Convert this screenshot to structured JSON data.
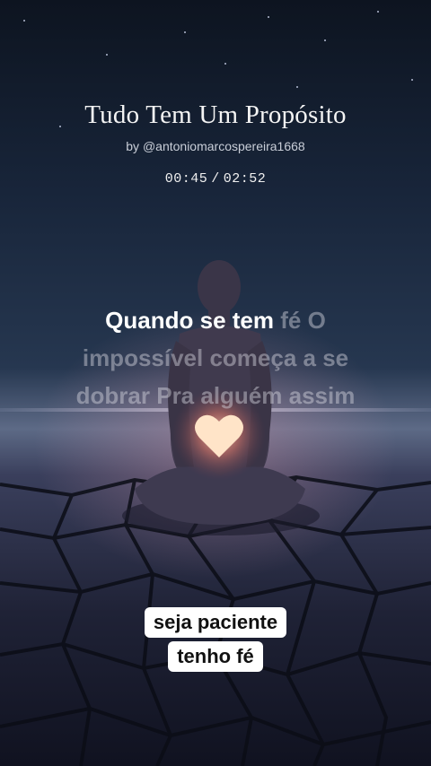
{
  "song": {
    "title": "Tudo Tem Um Propósito",
    "artist": "by @antoniomarcospereira1668"
  },
  "player": {
    "elapsed": "00:45",
    "separator": "/",
    "duration": "02:52",
    "progress_fraction": 0.262
  },
  "lyrics": {
    "sung": "Quando se tem",
    "current_tail": "fé O",
    "line2": "impossível começa a se",
    "line3": "dobrar Pra alguém assim"
  },
  "captions": {
    "line1": "seja paciente",
    "line2": "tenho fé"
  },
  "colors": {
    "sky_top": "#0d1420",
    "horizon": "#5d6a86",
    "heart_glow": "#ffd2b4",
    "caption_bg": "#ffffff"
  },
  "icons": {
    "heart": "glowing-heart-icon"
  }
}
